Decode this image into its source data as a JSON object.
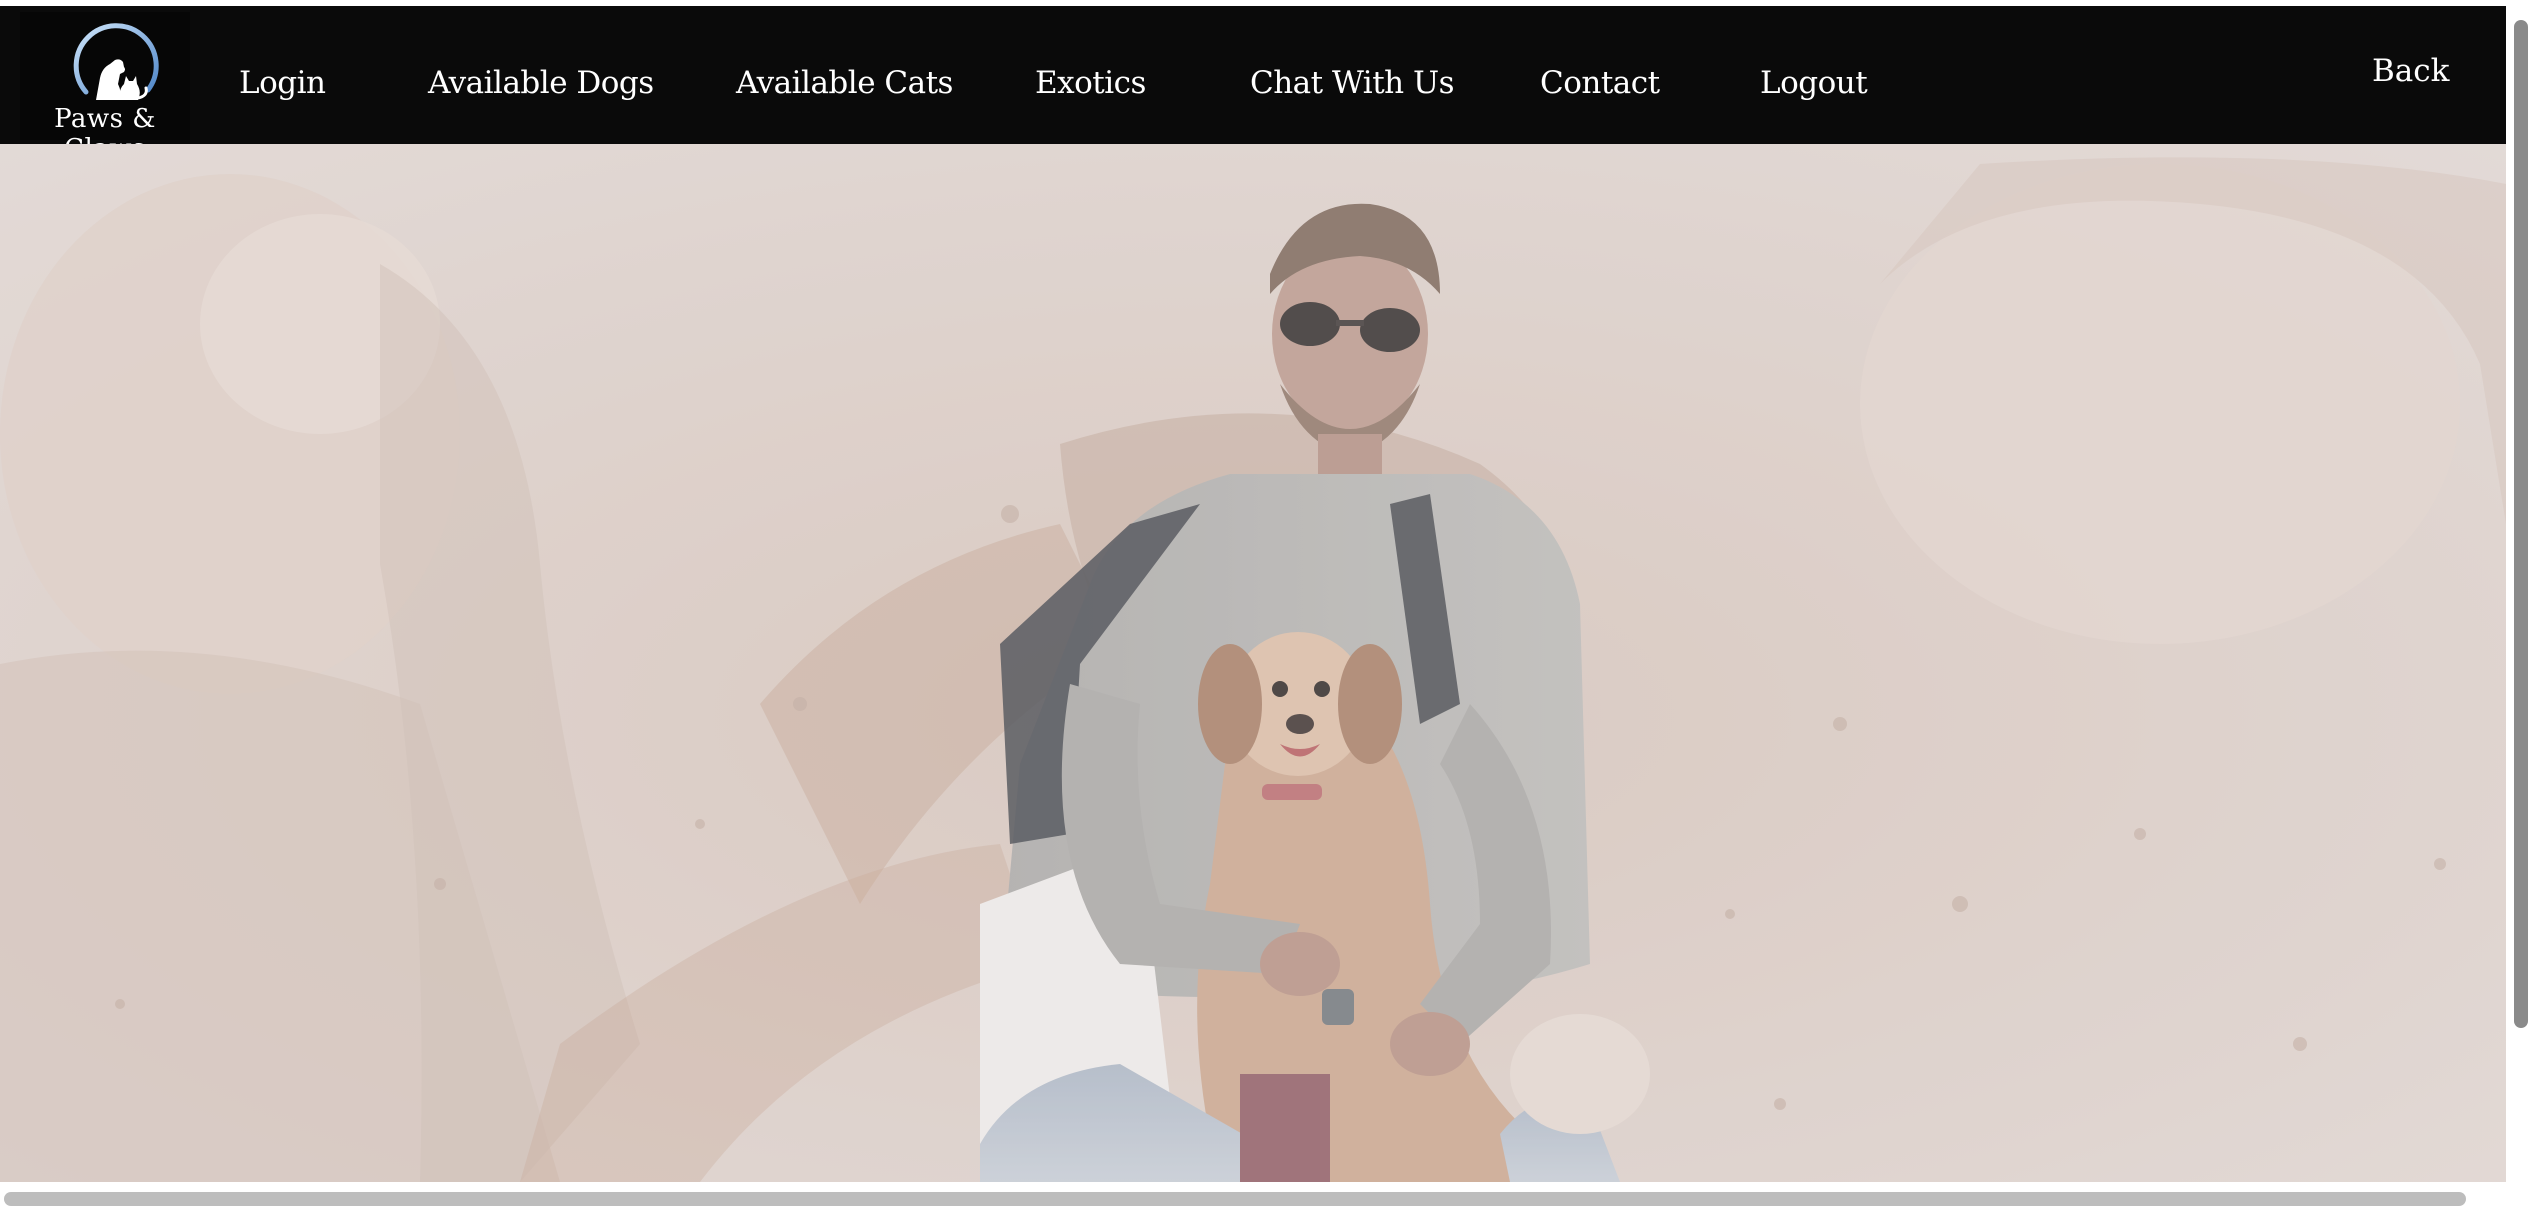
{
  "brand": {
    "name": "Paws & Claws",
    "logo_icon": "dog-and-cat-logo-icon"
  },
  "nav": {
    "items": [
      {
        "label": "Login"
      },
      {
        "label": "Available Dogs"
      },
      {
        "label": "Available Cats"
      },
      {
        "label": "Exotics"
      },
      {
        "label": "Chat With Us"
      },
      {
        "label": "Contact"
      },
      {
        "label": "Logout"
      }
    ],
    "back_label": "Back"
  },
  "hero": {
    "image": "faded-photo-man-holding-dog-collage"
  },
  "colors": {
    "navbar": "#0a0a0a",
    "nav_text": "#ffffff",
    "hero_overlay": "#d9cdc7",
    "logo_arc": "#7fb2e6"
  }
}
